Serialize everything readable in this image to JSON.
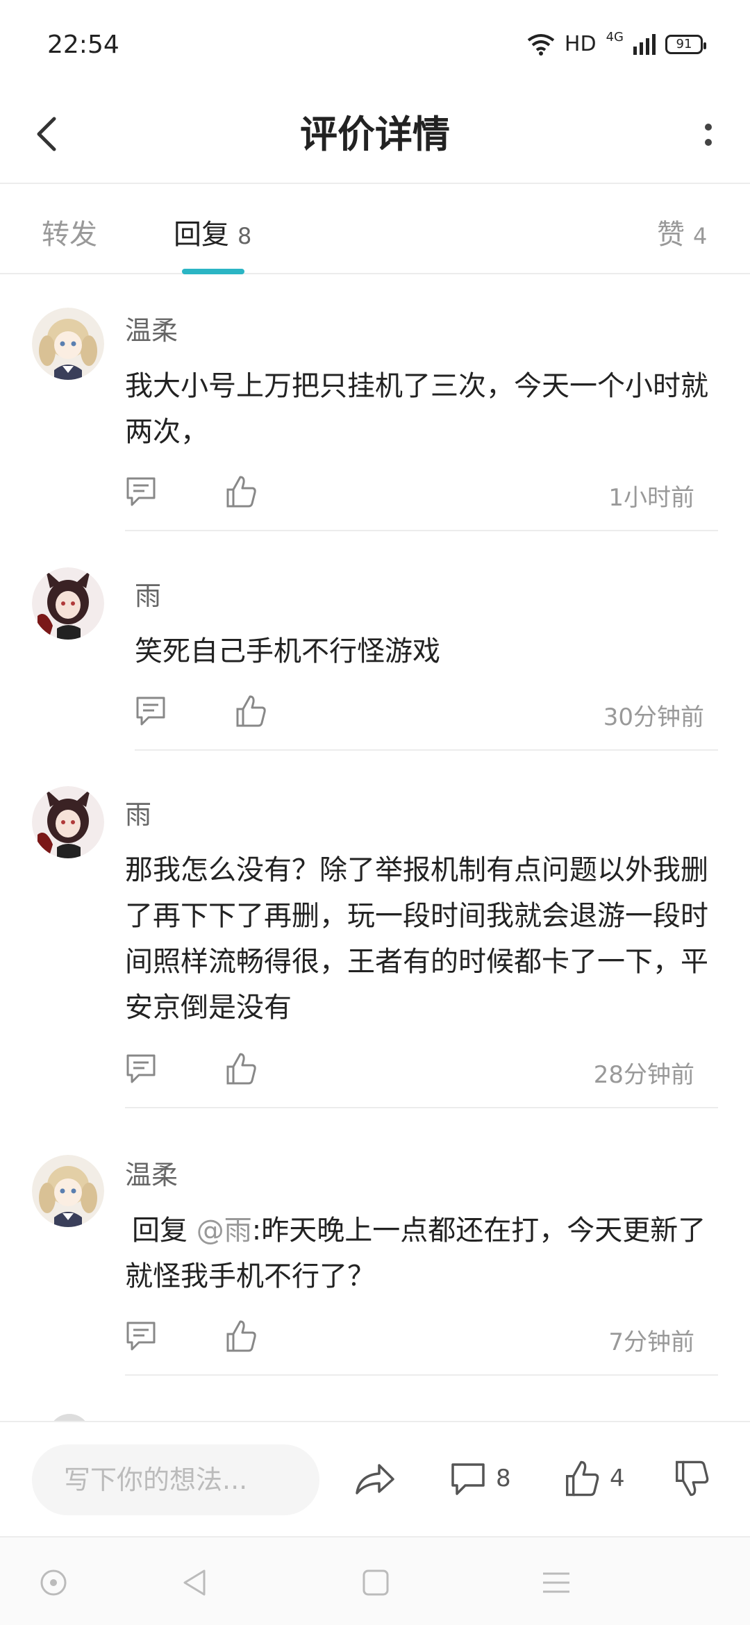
{
  "status_bar": {
    "time": "22:54",
    "signal_label": "HD",
    "network": "4G",
    "battery": "91"
  },
  "header": {
    "title": "评价详情"
  },
  "tabs": [
    {
      "label": "转发",
      "count": ""
    },
    {
      "label": "回复",
      "count": "8"
    },
    {
      "label": "赞",
      "count": "4"
    }
  ],
  "accent_color": "#2bb5c4",
  "comments": [
    {
      "user": "温柔",
      "avatar": "blonde-girl-avatar",
      "text": "我大小号上万把只挂机了三次，今天一个小时就两次，",
      "time": "1小时前"
    },
    {
      "user": "雨",
      "avatar": "fox-girl-avatar",
      "text": "笑死自己手机不行怪游戏",
      "time": "30分钟前"
    },
    {
      "user": "雨",
      "avatar": "fox-girl-avatar",
      "text": "那我怎么没有？除了举报机制有点问题以外我删了再下下了再删，玩一段时间我就会退游一段时间照样流畅得很，王者有的时候都卡了一下，平安京倒是没有",
      "time": "28分钟前"
    },
    {
      "user": "温柔",
      "avatar": "blonde-girl-avatar",
      "reply_prefix": "回复",
      "mention": "@雨",
      "text": ":昨天晚上一点都还在打，今天更新了就怪我手机不行了？",
      "time": "7分钟前"
    }
  ],
  "bottom_bar": {
    "placeholder": "写下你的想法...",
    "comment_count": "8",
    "like_count": "4"
  }
}
